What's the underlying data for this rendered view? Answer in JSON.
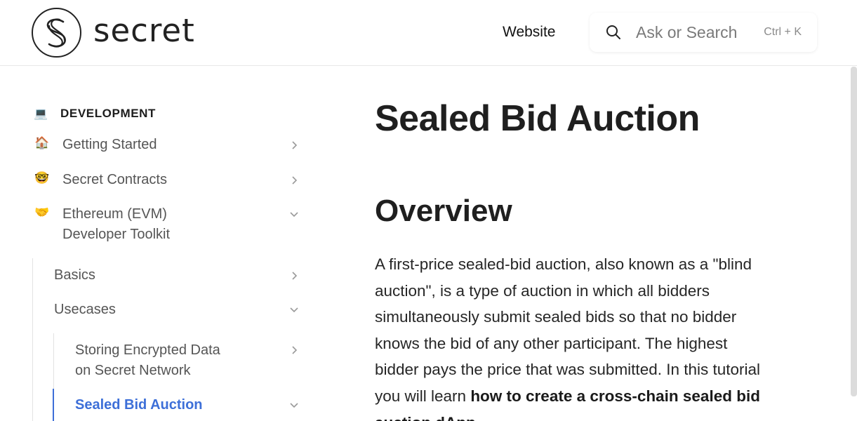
{
  "header": {
    "logo_text": "secret",
    "nav_website": "Website",
    "search_placeholder": "Ask or Search",
    "search_shortcut": "Ctrl + K"
  },
  "sidebar": {
    "section_title": "DEVELOPMENT",
    "section_icon": "laptop-icon",
    "items": [
      {
        "label": "Getting Started",
        "icon": "house-icon",
        "emoji": "🏠",
        "expanded": false
      },
      {
        "label": "Secret Contracts",
        "icon": "nerd-face-icon",
        "emoji": "🤓",
        "expanded": false
      },
      {
        "label": "Ethereum (EVM) Developer Toolkit",
        "line1": "Ethereum (EVM)",
        "line2": "Developer Toolkit",
        "icon": "handshake-icon",
        "emoji": "🤝",
        "expanded": true
      },
      {
        "label": "Basics",
        "expanded": false
      },
      {
        "label": "Usecases",
        "expanded": true
      },
      {
        "label": "Storing Encrypted Data on Secret Network",
        "line1": "Storing Encrypted Data",
        "line2": "on Secret Network",
        "expanded": false
      },
      {
        "label": "Sealed Bid Auction",
        "expanded": true,
        "active": true
      }
    ]
  },
  "main": {
    "title": "Sealed Bid Auction",
    "section_heading": "Overview",
    "paragraph_plain": "A first-price sealed-bid auction, also known as a \"blind auction\", is a type of auction in which all bidders simultaneously submit sealed bids so that no bidder knows the bid of any other participant. The highest bidder pays the price that was submitted. In this tutorial you will learn ",
    "paragraph_bold": "how to create a cross-chain sealed bid auction dApp"
  },
  "colors": {
    "accent": "#3d6fd8",
    "text": "#242424",
    "muted": "#555555"
  }
}
